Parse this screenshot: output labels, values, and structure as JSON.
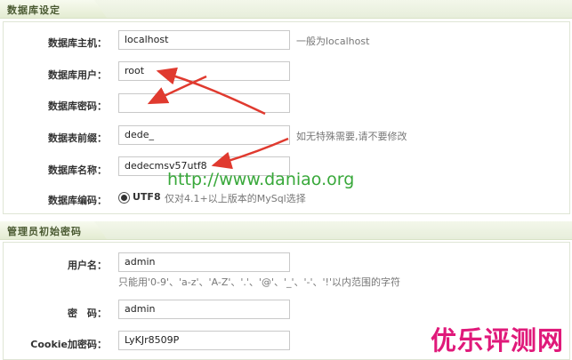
{
  "db_section": {
    "title": "数据库设定",
    "rows": {
      "host": {
        "label": "数据库主机：",
        "value": "localhost",
        "hint": "一般为localhost"
      },
      "user": {
        "label": "数据库用户：",
        "value": "root"
      },
      "password": {
        "label": "数据库密码：",
        "value": ""
      },
      "prefix": {
        "label": "数据表前缀：",
        "value": "dede_",
        "hint": "如无特殊需要,请不要修改"
      },
      "dbname": {
        "label": "数据库名称：",
        "value": "dedecmsv57utf8"
      },
      "encoding": {
        "label": "数据库编码：",
        "option": "UTF8",
        "hint": "仅对4.1+以上版本的MySql选择"
      }
    }
  },
  "admin_section": {
    "title": "管理员初始密码",
    "rows": {
      "username": {
        "label": "用户名：",
        "value": "admin",
        "hint": "只能用'0-9'、'a-z'、'A-Z'、'.'、'@'、'_'、'-'、'!'以内范围的字符"
      },
      "password": {
        "label": "密　码：",
        "value": "admin"
      },
      "cookie": {
        "label": "Cookie加密码：",
        "value": "LyKJr8509P"
      }
    }
  },
  "watermarks": {
    "url": "http://www.daniao.org",
    "brand": "优乐评测网"
  },
  "colors": {
    "arrow": "#e03a2f",
    "watermark_url": "#38a83a",
    "watermark_brand": "#e0197a",
    "section_bg": "#e7eedb"
  }
}
